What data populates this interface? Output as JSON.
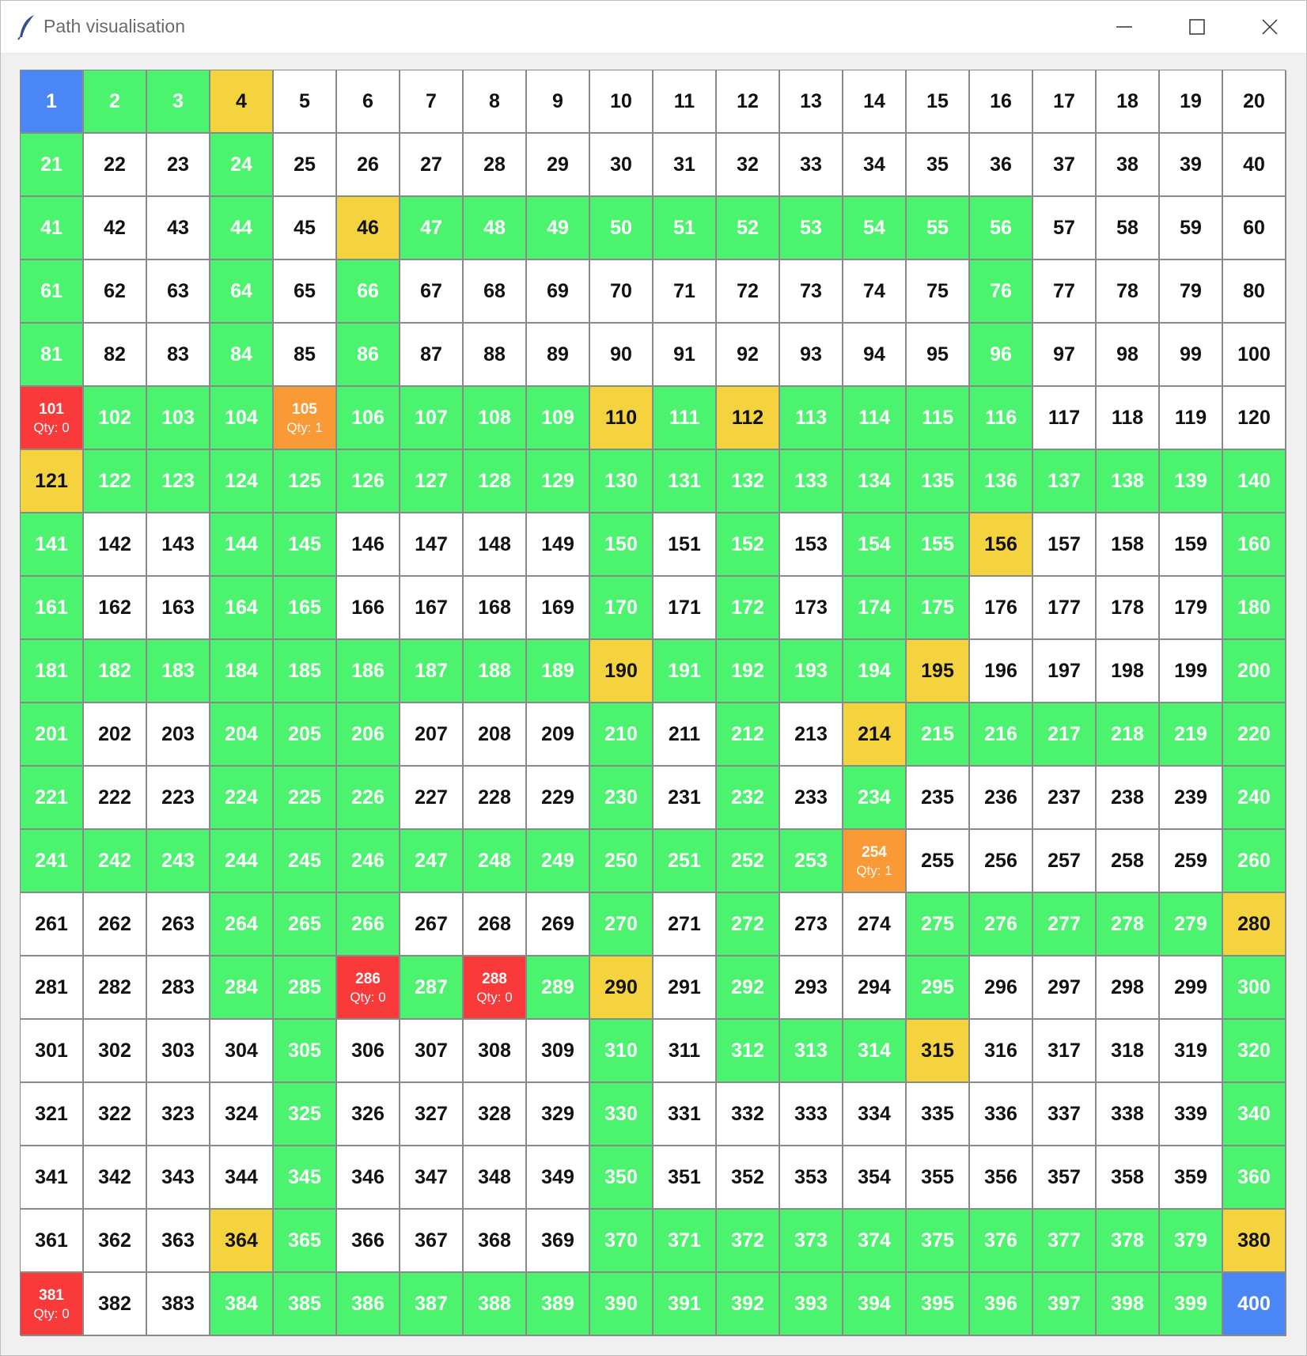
{
  "window": {
    "title": "Path visualisation",
    "icon": "feather-icon",
    "controls": [
      "minimize-icon",
      "maximize-icon",
      "close-icon"
    ]
  },
  "grid": {
    "rows": 20,
    "cols": 20,
    "colors": {
      "empty": "#ffffff",
      "path": "#4cf36e",
      "shelf": "#f5d33f",
      "endpoint": "#4a86f5",
      "low_stock": "#f99a36",
      "out_of_stock": "#f83a3a"
    },
    "endpoint_cells": [
      1,
      400
    ],
    "shelf_cells": [
      4,
      46,
      110,
      112,
      121,
      156,
      190,
      195,
      214,
      280,
      290,
      315,
      364,
      380
    ],
    "path_cells": [
      2,
      3,
      21,
      24,
      41,
      44,
      47,
      48,
      49,
      50,
      51,
      52,
      53,
      54,
      55,
      56,
      61,
      64,
      66,
      76,
      81,
      84,
      86,
      96,
      102,
      103,
      104,
      106,
      107,
      108,
      109,
      111,
      113,
      114,
      115,
      116,
      122,
      123,
      124,
      125,
      126,
      127,
      128,
      129,
      130,
      131,
      132,
      133,
      134,
      135,
      136,
      137,
      138,
      139,
      140,
      141,
      144,
      145,
      150,
      152,
      154,
      155,
      160,
      161,
      164,
      165,
      170,
      172,
      174,
      175,
      180,
      181,
      182,
      183,
      184,
      185,
      186,
      187,
      188,
      189,
      191,
      192,
      193,
      194,
      200,
      201,
      204,
      205,
      206,
      210,
      212,
      215,
      216,
      217,
      218,
      219,
      220,
      221,
      224,
      225,
      226,
      230,
      232,
      234,
      240,
      241,
      242,
      243,
      244,
      245,
      246,
      247,
      248,
      249,
      250,
      251,
      252,
      253,
      260,
      264,
      265,
      266,
      270,
      272,
      275,
      276,
      277,
      278,
      279,
      284,
      285,
      287,
      289,
      292,
      295,
      300,
      305,
      310,
      312,
      313,
      314,
      320,
      325,
      330,
      340,
      345,
      350,
      360,
      365,
      370,
      371,
      372,
      373,
      374,
      375,
      376,
      377,
      378,
      379,
      384,
      385,
      386,
      387,
      388,
      389,
      390,
      391,
      392,
      393,
      394,
      395,
      396,
      397,
      398,
      399
    ],
    "qty_cells": [
      {
        "cell": 101,
        "qty": "Qty: 0",
        "status": "red"
      },
      {
        "cell": 105,
        "qty": "Qty: 1",
        "status": "orange"
      },
      {
        "cell": 254,
        "qty": "Qty: 1",
        "status": "orange"
      },
      {
        "cell": 286,
        "qty": "Qty: 0",
        "status": "red"
      },
      {
        "cell": 288,
        "qty": "Qty: 0",
        "status": "red"
      },
      {
        "cell": 381,
        "qty": "Qty: 0",
        "status": "red"
      }
    ]
  }
}
